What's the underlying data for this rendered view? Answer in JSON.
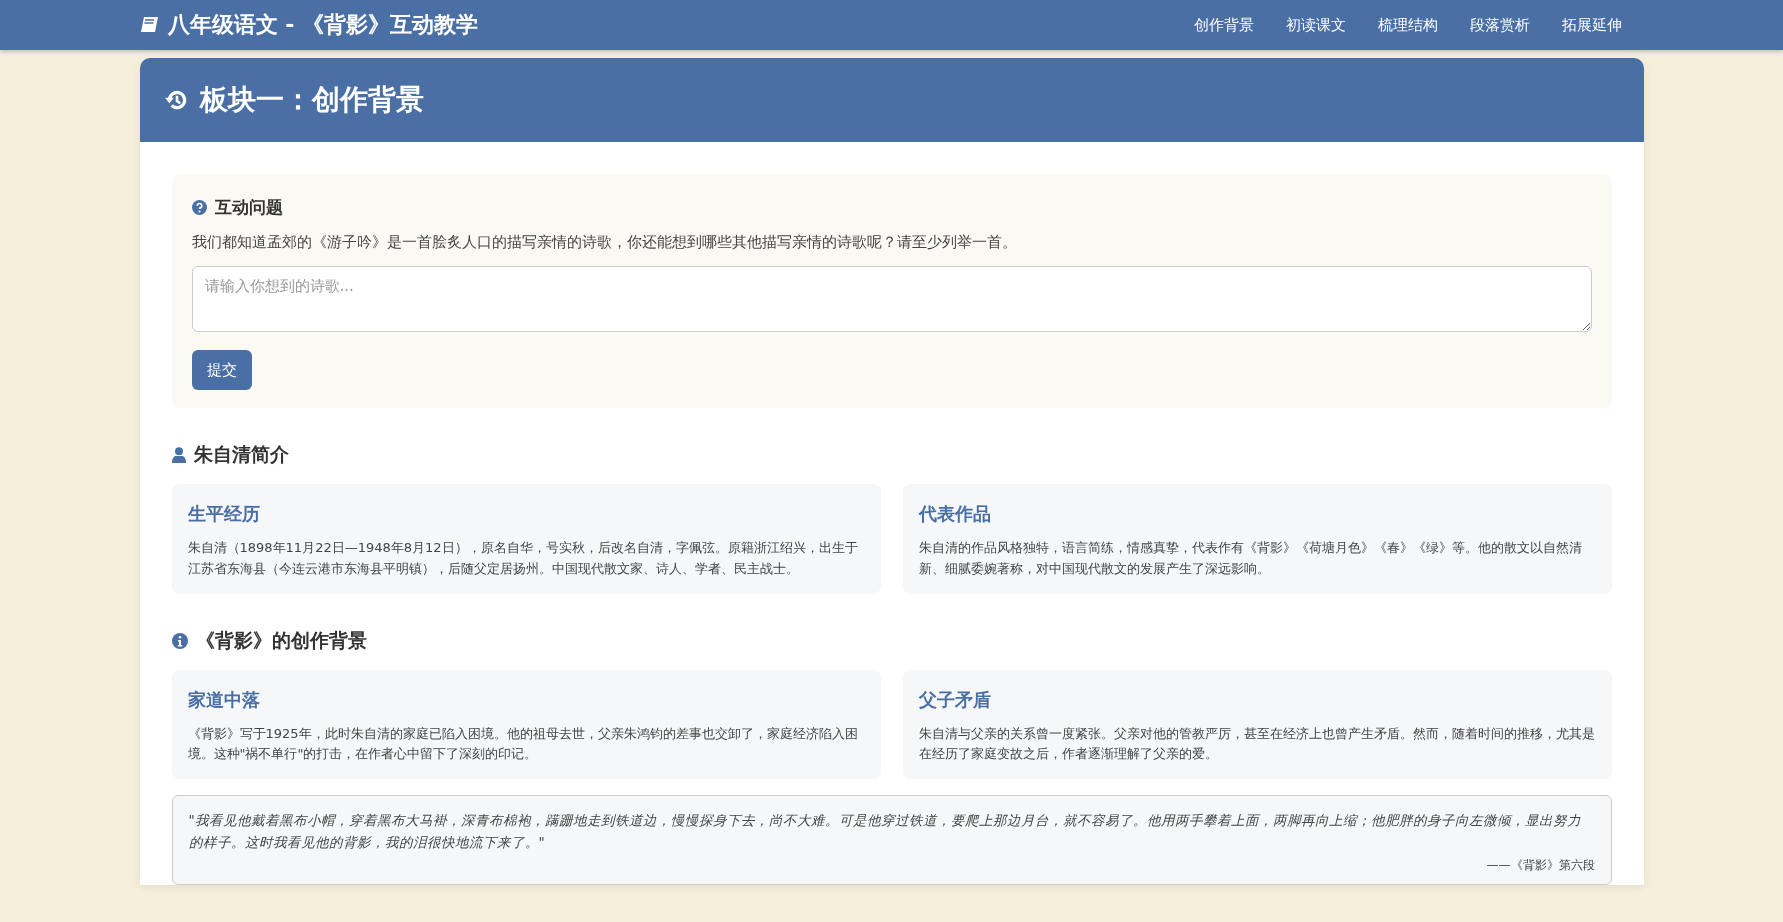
{
  "navbar": {
    "title": "八年级语文 - 《背影》互动教学",
    "links": [
      {
        "label": "创作背景"
      },
      {
        "label": "初读课文"
      },
      {
        "label": "梳理结构"
      },
      {
        "label": "段落赏析"
      },
      {
        "label": "拓展延伸"
      }
    ]
  },
  "module": {
    "title": "板块一：创作背景",
    "question": {
      "heading": "互动问题",
      "text": "我们都知道孟郊的《游子吟》是一首脍炙人口的描写亲情的诗歌，你还能想到哪些其他描写亲情的诗歌呢？请至少列举一首。",
      "placeholder": "请输入你想到的诗歌...",
      "button": "提交"
    },
    "sections": [
      {
        "kind": "user",
        "heading": "朱自清简介",
        "cards": [
          {
            "title": "生平经历",
            "text": "朱自清（1898年11月22日—1948年8月12日），原名自华，号实秋，后改名自清，字佩弦。原籍浙江绍兴，出生于江苏省东海县（今连云港市东海县平明镇），后随父定居扬州。中国现代散文家、诗人、学者、民主战士。"
          },
          {
            "title": "代表作品",
            "text": "朱自清的作品风格独特，语言简练，情感真挚，代表作有《背影》《荷塘月色》《春》《绿》等。他的散文以自然清新、细腻委婉著称，对中国现代散文的发展产生了深远影响。"
          }
        ]
      },
      {
        "kind": "info",
        "heading": "《背影》的创作背景",
        "cards": [
          {
            "title": "家道中落",
            "text": "《背影》写于1925年，此时朱自清的家庭已陷入困境。他的祖母去世，父亲朱鸿钧的差事也交卸了，家庭经济陷入困境。这种\"祸不单行\"的打击，在作者心中留下了深刻的印记。"
          },
          {
            "title": "父子矛盾",
            "text": "朱自清与父亲的关系曾一度紧张。父亲对他的管教严厉，甚至在经济上也曾产生矛盾。然而，随着时间的推移，尤其是在经历了家庭变故之后，作者逐渐理解了父亲的爱。"
          }
        ]
      }
    ],
    "quote": {
      "text": "\"我看见他戴着黑布小帽，穿着黑布大马褂，深青布棉袍，蹒跚地走到铁道边，慢慢探身下去，尚不大难。可是他穿过铁道，要爬上那边月台，就不容易了。他用两手攀着上面，两脚再向上缩；他肥胖的身子向左微倾，显出努力的样子。这时我看见他的背影，我的泪很快地流下来了。\"",
      "source": "——《背影》第六段"
    }
  }
}
